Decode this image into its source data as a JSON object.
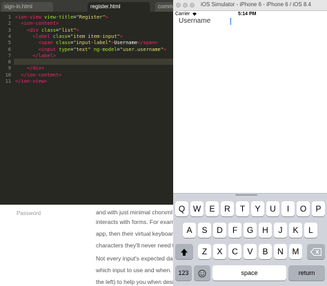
{
  "editor": {
    "tabs": [
      {
        "label": "sign-in.html"
      },
      {
        "label": "register.html"
      },
      {
        "label": "comm"
      }
    ],
    "lines": [
      {
        "no": "1",
        "tokens": [
          {
            "t": "<",
            "c": "tag"
          },
          {
            "t": "ion-view",
            "c": "tag"
          },
          {
            "t": " view-title",
            "c": "attr"
          },
          {
            "t": "=",
            "c": "txt"
          },
          {
            "t": "\"Register\"",
            "c": "str"
          },
          {
            "t": ">",
            "c": "tag"
          }
        ]
      },
      {
        "no": "2",
        "tokens": [
          {
            "t": "  <",
            "c": "tag"
          },
          {
            "t": "ion-content",
            "c": "tag"
          },
          {
            "t": ">",
            "c": "tag"
          }
        ]
      },
      {
        "no": "3",
        "tokens": [
          {
            "t": "    <",
            "c": "tag"
          },
          {
            "t": "div",
            "c": "tag"
          },
          {
            "t": " class",
            "c": "attr"
          },
          {
            "t": "=",
            "c": "txt"
          },
          {
            "t": "\"list\"",
            "c": "str"
          },
          {
            "t": ">",
            "c": "tag"
          }
        ]
      },
      {
        "no": "4",
        "tokens": [
          {
            "t": "      <",
            "c": "tag"
          },
          {
            "t": "label",
            "c": "tag"
          },
          {
            "t": " class",
            "c": "attr"
          },
          {
            "t": "=",
            "c": "txt"
          },
          {
            "t": "\"item item-input\"",
            "c": "str"
          },
          {
            "t": ">",
            "c": "tag"
          }
        ]
      },
      {
        "no": "5",
        "tokens": [
          {
            "t": "        <",
            "c": "tag"
          },
          {
            "t": "span",
            "c": "tag"
          },
          {
            "t": " class",
            "c": "attr"
          },
          {
            "t": "=",
            "c": "txt"
          },
          {
            "t": "\"input-label\"",
            "c": "str"
          },
          {
            "t": ">",
            "c": "tag"
          },
          {
            "t": "Username",
            "c": "txt"
          },
          {
            "t": "</",
            "c": "tag"
          },
          {
            "t": "span",
            "c": "tag"
          },
          {
            "t": ">",
            "c": "tag"
          }
        ]
      },
      {
        "no": "6",
        "tokens": [
          {
            "t": "        <",
            "c": "tag"
          },
          {
            "t": "input",
            "c": "tag"
          },
          {
            "t": " type",
            "c": "attr"
          },
          {
            "t": "=",
            "c": "txt"
          },
          {
            "t": "\"text\"",
            "c": "str"
          },
          {
            "t": " ng-model",
            "c": "attr"
          },
          {
            "t": "=",
            "c": "txt"
          },
          {
            "t": "\"user.username\"",
            "c": "str"
          },
          {
            "t": ">",
            "c": "tag"
          }
        ]
      },
      {
        "no": "7",
        "tokens": [
          {
            "t": "      </",
            "c": "tag"
          },
          {
            "t": "label",
            "c": "tag"
          },
          {
            "t": ">",
            "c": "tag"
          }
        ]
      },
      {
        "no": "8",
        "tokens": []
      },
      {
        "no": "9",
        "tokens": [
          {
            "t": "    </",
            "c": "tag"
          },
          {
            "t": "div",
            "c": "tag"
          },
          {
            "t": ">",
            "c": "tag"
          }
        ]
      },
      {
        "no": "10",
        "tokens": [
          {
            "t": "  </",
            "c": "tag"
          },
          {
            "t": "ion-content",
            "c": "tag"
          },
          {
            "t": ">",
            "c": "tag"
          }
        ]
      },
      {
        "no": "11",
        "tokens": [
          {
            "t": "</",
            "c": "tag"
          },
          {
            "t": "ion-view",
            "c": "tag"
          },
          {
            "t": ">",
            "c": "tag"
          }
        ]
      }
    ]
  },
  "background_page": {
    "label": "Password",
    "lines": [
      "and with just minimal chorxml",
      "interacts with forms. For exam",
      "app, then their virtual keyboar",
      "characters they'll never need t",
      "Not every input's expected da",
      "which input to use and when.",
      "the left) to help you when desi"
    ]
  },
  "simulator": {
    "title": "iOS Simulator - iPhone 6 - iPhone 6 / iOS 8.4",
    "carrier": "Carrier",
    "wifi_icon": "wifi-icon",
    "time": "5:14 PM",
    "username_label": "Username"
  },
  "keyboard": {
    "row1": [
      "Q",
      "W",
      "E",
      "R",
      "T",
      "Y",
      "U",
      "I",
      "O",
      "P"
    ],
    "row2": [
      "A",
      "S",
      "D",
      "F",
      "G",
      "H",
      "J",
      "K",
      "L"
    ],
    "row3": [
      "Z",
      "X",
      "C",
      "V",
      "B",
      "N",
      "M"
    ],
    "shift_icon": "shift-arrow-icon",
    "delete_icon": "delete-backspace-icon",
    "numbers_label": "123",
    "emoji_icon": "emoji-icon",
    "space_label": "space",
    "return_label": "return"
  },
  "colors": {
    "editor_bg": "#272822",
    "tag": "#f92672",
    "attr": "#a6e22e",
    "string": "#e6db74",
    "keyboard_bg": "#d1d4da",
    "caret": "#1a73e8"
  }
}
